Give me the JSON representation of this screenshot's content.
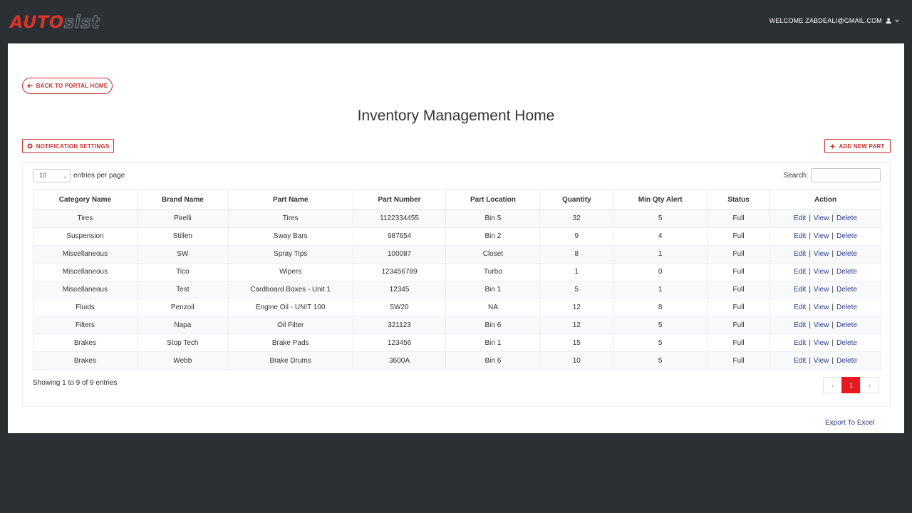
{
  "header": {
    "logo_part1": "AUTO",
    "logo_part2": "sist",
    "welcome_text": "WELCOME ZABDEALI@GMAIL.COM"
  },
  "back_label": "BACK TO PORTAL HOME",
  "page_title": "Inventory Management Home",
  "notification_label": "NOTIFICATION SETTINGS",
  "add_part_label": "ADD NEW PART",
  "length": {
    "value": "10",
    "suffix": "entries per page"
  },
  "search_label": "Search:",
  "table": {
    "columns": [
      "Category Name",
      "Brand Name",
      "Part Name",
      "Part Number",
      "Part Location",
      "Quantity",
      "Min Qty Alert",
      "Status",
      "Action"
    ],
    "rows": [
      [
        "Tires",
        "Pirelli",
        "Tires",
        "1122334455",
        "Bin 5",
        "32",
        "5",
        "Full"
      ],
      [
        "Suspension",
        "Stillen",
        "Sway Bars",
        "987654",
        "Bin 2",
        "9",
        "4",
        "Full"
      ],
      [
        "Miscellaneous",
        "SW",
        "Spray Tips",
        "100087",
        "Closet",
        "8",
        "1",
        "Full"
      ],
      [
        "Miscellaneous",
        "Tico",
        "Wipers",
        "123456789",
        "Turbo",
        "1",
        "0",
        "Full"
      ],
      [
        "Miscellaneous",
        "Test",
        "Cardboard Boxes - Unit 1",
        "12345",
        "Bin 1",
        "5",
        "1",
        "Full"
      ],
      [
        "Fluids",
        "Penzoil",
        "Engine Oil - UNIT 100",
        "5W20",
        "NA",
        "12",
        "8",
        "Full"
      ],
      [
        "Filters",
        "Napa",
        "Oil Filter",
        "321123",
        "Bin 6",
        "12",
        "5",
        "Full"
      ],
      [
        "Brakes",
        "Stop Tech",
        "Brake Pads",
        "123456",
        "Bin 1",
        "15",
        "5",
        "Full"
      ],
      [
        "Brakes",
        "Webb",
        "Brake Drums",
        "3600A",
        "Bin 6",
        "10",
        "5",
        "Full"
      ]
    ],
    "actions": {
      "edit": "Edit",
      "view": "View",
      "delete": "Delete",
      "separator": "|"
    }
  },
  "info_text": "Showing 1 to 9 of 9 entries",
  "pagination": {
    "prev": "‹",
    "current": "1",
    "next": "›"
  },
  "export_label": "Export To Excel",
  "colors": {
    "accent": "#c9302c",
    "active_page": "#e8191f",
    "link": "#2d3a8c",
    "topbar": "#2b3035"
  }
}
